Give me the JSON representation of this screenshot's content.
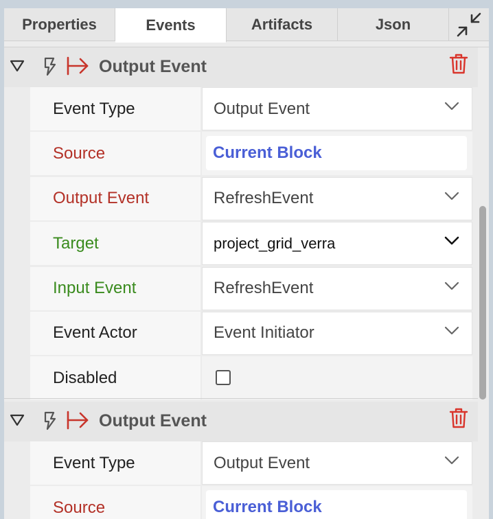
{
  "tabs": [
    {
      "label": "Properties"
    },
    {
      "label": "Events"
    },
    {
      "label": "Artifacts"
    },
    {
      "label": "Json"
    }
  ],
  "events": [
    {
      "title": "Output Event",
      "rows": [
        {
          "label": "Event Type",
          "value": "Output Event"
        },
        {
          "label": "Source",
          "value": "Current Block"
        },
        {
          "label": "Output Event",
          "value": "RefreshEvent"
        },
        {
          "label": "Target",
          "value": "project_grid_verra"
        },
        {
          "label": "Input Event",
          "value": "RefreshEvent"
        },
        {
          "label": "Event Actor",
          "value": "Event Initiator"
        },
        {
          "label": "Disabled",
          "value": ""
        }
      ]
    },
    {
      "title": "Output Event",
      "rows": [
        {
          "label": "Event Type",
          "value": "Output Event"
        },
        {
          "label": "Source",
          "value": "Current Block"
        }
      ]
    }
  ],
  "colors": {
    "required_label": "#b33127",
    "target_label": "#3a8b1e",
    "source_value": "#4a5fd6",
    "trash": "#d9342b",
    "output_arrow": "#c8352b"
  },
  "icons": {
    "collapse": "collapse-arrows-icon",
    "toggle": "triangle-down-icon",
    "event": "lightning-bolt-icon",
    "output": "output-arrow-icon",
    "delete": "trash-icon",
    "dropdown": "chevron-down-icon"
  }
}
